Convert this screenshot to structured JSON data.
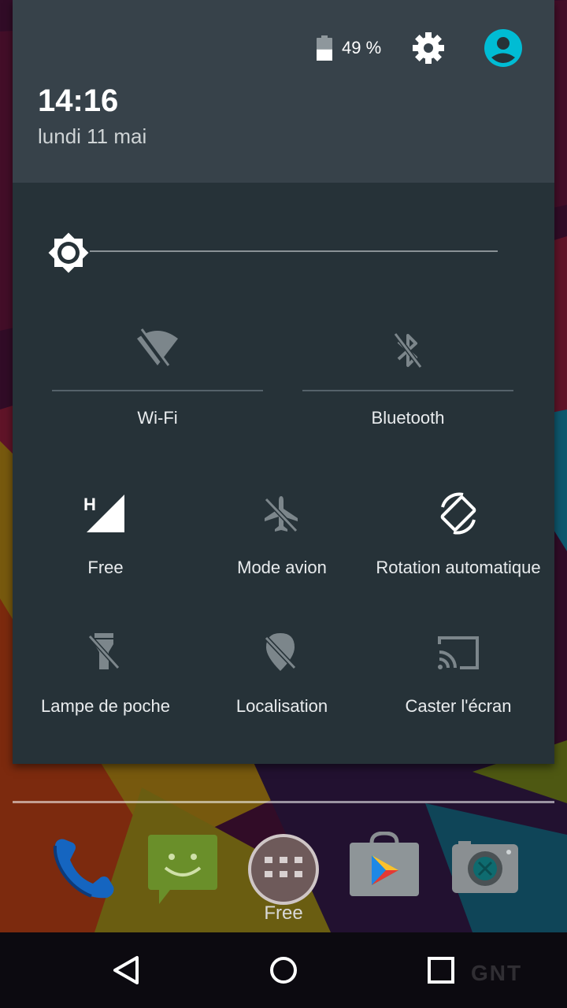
{
  "status": {
    "battery_percent": "49 %",
    "battery_level": 0.49
  },
  "header": {
    "time": "14:16",
    "date": "lundi 11 mai"
  },
  "brightness": {
    "level": 0.0
  },
  "tiles": {
    "wifi": {
      "label": "Wi-Fi",
      "icon": "wifi-off-icon",
      "enabled": false
    },
    "bluetooth": {
      "label": "Bluetooth",
      "icon": "bluetooth-off-icon",
      "enabled": false
    },
    "mobile": {
      "label": "Free",
      "icon": "cellular-signal-icon",
      "network_type": "H",
      "enabled": true
    },
    "airplane": {
      "label": "Mode avion",
      "icon": "airplane-off-icon",
      "enabled": false
    },
    "rotation": {
      "label": "Rotation automatique",
      "icon": "screen-rotation-icon",
      "enabled": true
    },
    "flashlight": {
      "label": "Lampe de poche",
      "icon": "flashlight-off-icon",
      "enabled": false
    },
    "location": {
      "label": "Localisation",
      "icon": "location-off-icon",
      "enabled": false
    },
    "cast": {
      "label": "Caster l'écran",
      "icon": "cast-icon",
      "enabled": false
    }
  },
  "dock": {
    "apps_label": "Free",
    "items": [
      "phone-app-icon",
      "messaging-app-icon",
      "app-drawer-icon",
      "play-store-icon",
      "camera-app-icon"
    ]
  },
  "navigation": {
    "buttons": [
      "back-button",
      "home-button",
      "recents-button"
    ]
  },
  "watermark": "GNT",
  "colors": {
    "shade_bg": "#263238",
    "header_bg": "#37424a",
    "accent": "#00bcd4",
    "active_icon": "#ffffff",
    "inactive_icon": "#7c868b"
  }
}
